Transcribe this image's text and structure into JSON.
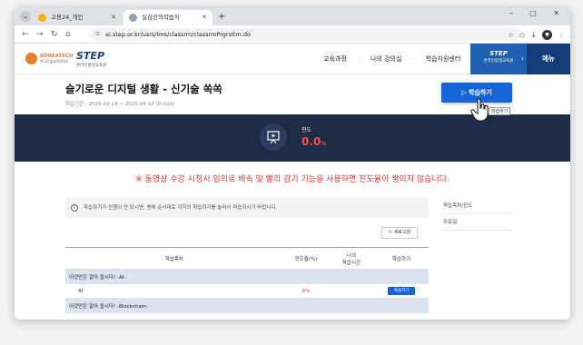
{
  "browser": {
    "tabs": [
      {
        "title": "고용24_개인",
        "favicon_color": "#f4b400"
      },
      {
        "title": "실감강의학습자",
        "favicon_color": "#5f6368"
      }
    ],
    "url": "ai.step.or.kr/usrs/lms/classrm/classrmPrgrsItm.do"
  },
  "site": {
    "logo1_name": "KOREATECH",
    "logo1_sub": "한국기술교육대학교",
    "logo2_name": "STEP",
    "logo2_sub": "온라인평생교육원",
    "nav": [
      "교육과정",
      "나의 강의실",
      "학습지원센터"
    ],
    "banner_title": "STEP",
    "banner_sub": "온라인평생교육원",
    "menu_label": "메뉴"
  },
  "course": {
    "title": "슬기로운 디지털 생활 - 신기술 쏙쏙",
    "period_label": "학습기간 : 2025-03-14 ~ 2025-04-12",
    "dday": "(D-029)",
    "study_button": "학습하기",
    "tooltip": "학습하기"
  },
  "progress": {
    "label": "진도",
    "value": "0.0",
    "unit": "%",
    "fraction": 0.0
  },
  "notice": "※ 동영상 수강 시청시 임의로 배속 및 빨리 감기 기능을 사용하면 진도율이 쌓이지 않습니다.",
  "content": {
    "info": "학습하기가 진행이 안 되시면, 맨에 순서대로 각각의 학습하기를 눌러서 학습하시기 바랍니다.",
    "refresh_label": "새로고침",
    "headers": {
      "contents": "학습목차",
      "progress": "진도율(%)",
      "time_line1": "나의",
      "time_line2": "학습시간",
      "action": "학습하기"
    },
    "rows": [
      {
        "type": "section",
        "label": "이것만은 알아 둡시다! -AI-"
      },
      {
        "type": "item",
        "label": "AI",
        "progress": "0%",
        "time": "",
        "action": "학습하기"
      },
      {
        "type": "section",
        "label": "이것만은 알아 둡시다! -Blockchain-"
      }
    ]
  },
  "side_nav": [
    "학습목차/진도",
    "자료실"
  ]
}
